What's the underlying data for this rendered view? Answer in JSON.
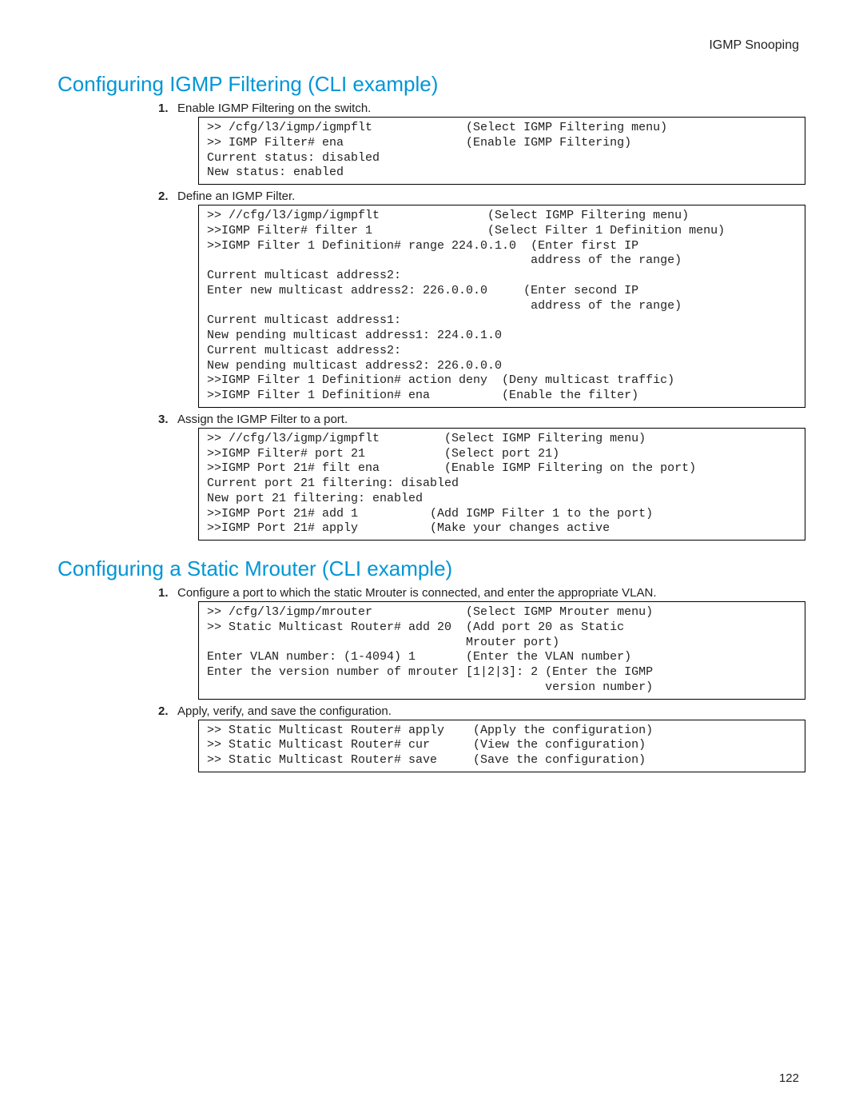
{
  "chapter": "IGMP Snooping",
  "page_number": "122",
  "section1": {
    "title": "Configuring IGMP Filtering (CLI example)",
    "step1": {
      "text": "Enable IGMP Filtering on the switch.",
      "code": ">> /cfg/l3/igmp/igmpflt             (Select IGMP Filtering menu)\n>> IGMP Filter# ena                 (Enable IGMP Filtering)\nCurrent status: disabled\nNew status: enabled"
    },
    "step2": {
      "text": "Define an IGMP Filter.",
      "code": ">> //cfg/l3/igmp/igmpflt               (Select IGMP Filtering menu)\n>>IGMP Filter# filter 1                (Select Filter 1 Definition menu)\n>>IGMP Filter 1 Definition# range 224.0.1.0  (Enter first IP\n                                             address of the range)\nCurrent multicast address2:\nEnter new multicast address2: 226.0.0.0     (Enter second IP\n                                             address of the range)\nCurrent multicast address1:\nNew pending multicast address1: 224.0.1.0\nCurrent multicast address2:\nNew pending multicast address2: 226.0.0.0\n>>IGMP Filter 1 Definition# action deny  (Deny multicast traffic)\n>>IGMP Filter 1 Definition# ena          (Enable the filter)"
    },
    "step3": {
      "text": "Assign the IGMP Filter to a port.",
      "code": ">> //cfg/l3/igmp/igmpflt         (Select IGMP Filtering menu)\n>>IGMP Filter# port 21           (Select port 21)\n>>IGMP Port 21# filt ena         (Enable IGMP Filtering on the port)\nCurrent port 21 filtering: disabled\nNew port 21 filtering: enabled\n>>IGMP Port 21# add 1          (Add IGMP Filter 1 to the port)\n>>IGMP Port 21# apply          (Make your changes active"
    }
  },
  "section2": {
    "title": "Configuring a Static Mrouter (CLI example)",
    "step1": {
      "text": "Configure a port to which the static Mrouter is connected, and enter the appropriate VLAN.",
      "code": ">> /cfg/l3/igmp/mrouter             (Select IGMP Mrouter menu)\n>> Static Multicast Router# add 20  (Add port 20 as Static\n                                    Mrouter port)\nEnter VLAN number: (1-4094) 1       (Enter the VLAN number)\nEnter the version number of mrouter [1|2|3]: 2 (Enter the IGMP\n                                               version number)"
    },
    "step2": {
      "text": "Apply, verify, and save the configuration.",
      "code": ">> Static Multicast Router# apply    (Apply the configuration)\n>> Static Multicast Router# cur      (View the configuration)\n>> Static Multicast Router# save     (Save the configuration)"
    }
  }
}
